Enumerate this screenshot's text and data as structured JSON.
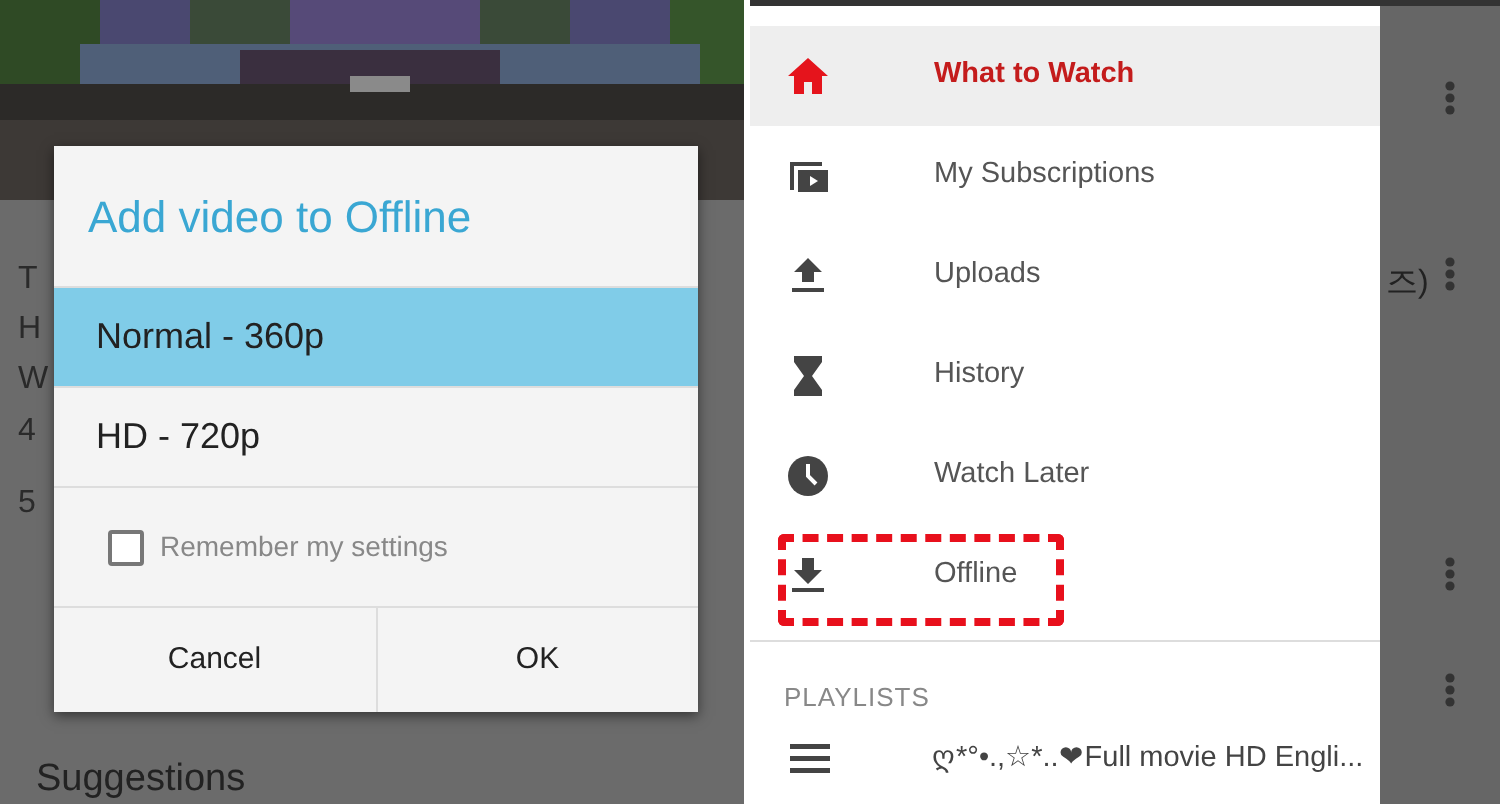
{
  "left_screen": {
    "background": {
      "kind": "picture"
    },
    "peek_texts": [
      "T",
      "H",
      "W",
      "4",
      "5"
    ],
    "suggestions_heading": "Suggestions",
    "dialog": {
      "title": "Add video to Offline",
      "options": [
        {
          "label": "Normal - 360p",
          "selected": true
        },
        {
          "label": "HD - 720p",
          "selected": false
        }
      ],
      "remember": {
        "label": "Remember my settings",
        "checked": false
      },
      "buttons": [
        "Cancel",
        "OK"
      ]
    }
  },
  "right_screen": {
    "drawer": {
      "items": [
        {
          "label": "What to Watch",
          "selected": true,
          "highlighted": false
        },
        {
          "label": "My Subscriptions",
          "selected": false,
          "highlighted": false
        },
        {
          "label": "Uploads",
          "selected": false,
          "highlighted": false
        },
        {
          "label": "History",
          "selected": false,
          "highlighted": false
        },
        {
          "label": "Watch Later",
          "selected": false,
          "highlighted": false
        },
        {
          "label": "Offline",
          "selected": false,
          "highlighted": true
        }
      ],
      "section_heading": "PLAYLISTS",
      "playlists": [
        {
          "label": "ღ*°•.,☆*..❤Full movie HD Engli..."
        }
      ]
    },
    "behind_texts": [
      "즈)"
    ]
  }
}
